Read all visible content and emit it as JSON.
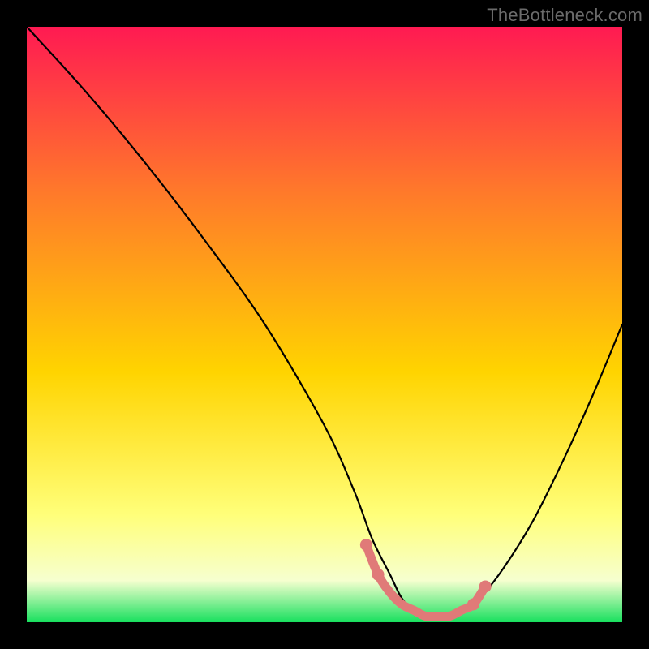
{
  "watermark": {
    "text": "TheBottleneck.com"
  },
  "gradient_colors": {
    "top": "#ff1a52",
    "mid_upper": "#ff7a2a",
    "mid": "#ffd400",
    "mid_lower": "#ffff7a",
    "pale": "#f6ffcf",
    "bottom": "#18e05e"
  },
  "chart_data": {
    "type": "line",
    "title": "",
    "xlabel": "",
    "ylabel": "",
    "xlim": [
      0,
      100
    ],
    "ylim": [
      0,
      100
    ],
    "series": [
      {
        "name": "bottleneck-curve",
        "x": [
          0,
          10,
          20,
          30,
          40,
          50,
          55,
          58,
          61,
          63,
          65,
          67,
          69,
          71,
          73,
          76,
          80,
          85,
          90,
          95,
          100
        ],
        "values": [
          100,
          89,
          77,
          64,
          50,
          33,
          22,
          14,
          8,
          4,
          2,
          1,
          1,
          1,
          2,
          4,
          9,
          17,
          27,
          38,
          50
        ]
      }
    ],
    "highlight_segment": {
      "name": "optimal-band",
      "color": "#e07a78",
      "x": [
        57,
        59,
        61,
        63,
        65,
        67,
        69,
        71,
        73,
        75,
        77
      ],
      "values": [
        13,
        8,
        5,
        3,
        2,
        1,
        1,
        1,
        2,
        3,
        6
      ]
    },
    "highlight_dots": {
      "name": "marker-dots",
      "color": "#e07a78",
      "points": [
        {
          "x": 57,
          "y": 13
        },
        {
          "x": 59,
          "y": 8
        },
        {
          "x": 75,
          "y": 3
        },
        {
          "x": 77,
          "y": 6
        }
      ]
    }
  }
}
